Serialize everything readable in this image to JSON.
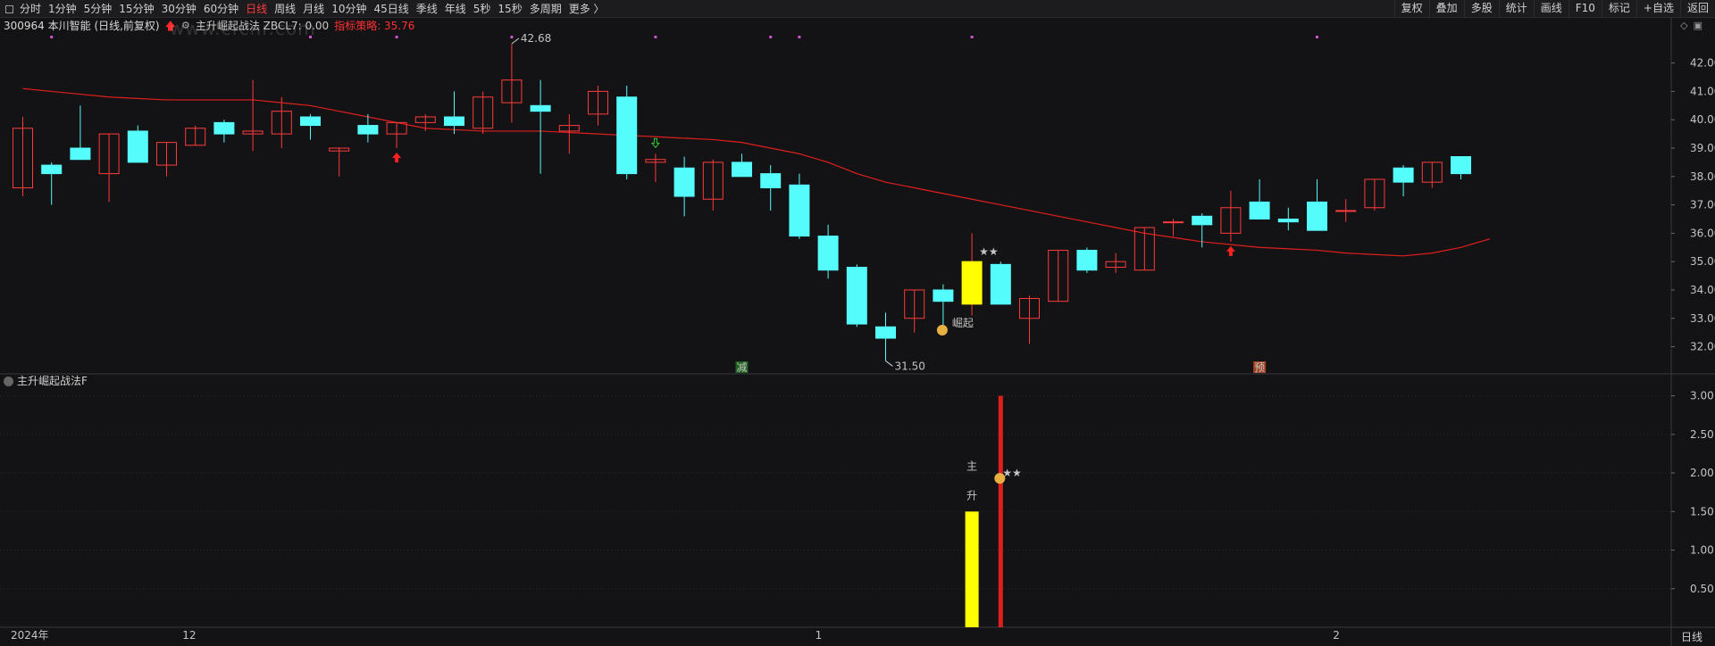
{
  "toolbar": {
    "periods": [
      "分时",
      "1分钟",
      "5分钟",
      "15分钟",
      "30分钟",
      "60分钟",
      "日线",
      "周线",
      "月线",
      "10分钟",
      "45日线",
      "季线",
      "年线",
      "5秒",
      "15秒",
      "多周期",
      "更多 〉"
    ],
    "active_period": "日线",
    "right_buttons": [
      "复权",
      "叠加",
      "多股",
      "统计",
      "画线",
      "F10",
      "标记",
      "+自选",
      "返回"
    ]
  },
  "info": {
    "stock": "300964 本川智能 (日线,前复权)",
    "formula": "主升崛起战法 ZBCL7: 0.00",
    "strategy": "指标策略: 35.76",
    "watermark": "www.cfcnr.com"
  },
  "subchart": {
    "title": "主升崛起战法F",
    "period": "日线"
  },
  "colors": {
    "up": "#ff3b3b",
    "down": "#54fcfc",
    "ma": "#e01e1e",
    "yellow": "#ffff00",
    "background": "#131315"
  },
  "chart_data": [
    {
      "type": "candlestick",
      "name": "main",
      "ylim": [
        31.2,
        42.9
      ],
      "y_ticks": [
        "42.00",
        "41.00",
        "40.00",
        "39.00",
        "38.00",
        "37.00",
        "36.00",
        "35.00",
        "34.00",
        "33.00",
        "32.00"
      ],
      "x_labels": [
        {
          "label": "2024年",
          "index": 0
        },
        {
          "label": "12",
          "index": 6
        },
        {
          "label": "1",
          "index": 28
        },
        {
          "label": "2",
          "index": 46
        }
      ],
      "annotations": [
        {
          "text": "42.68",
          "index": 17,
          "value": 42.68
        },
        {
          "text": "31.50",
          "index": 30,
          "value": 31.5
        },
        {
          "text": "崛起",
          "index": 32,
          "value": 32.9
        },
        {
          "text": "★★",
          "index": 33,
          "value": 35.1
        },
        {
          "text": "减",
          "index": 25,
          "value": 31.35
        },
        {
          "text": "预",
          "index": 43,
          "value": 31.35
        }
      ],
      "candles": [
        {
          "o": 37.6,
          "h": 40.1,
          "l": 37.3,
          "c": 39.7
        },
        {
          "o": 38.4,
          "h": 38.5,
          "l": 37.0,
          "c": 38.1
        },
        {
          "o": 39.0,
          "h": 40.5,
          "l": 38.6,
          "c": 38.6
        },
        {
          "o": 38.1,
          "h": 39.5,
          "l": 37.1,
          "c": 39.5
        },
        {
          "o": 39.6,
          "h": 39.8,
          "l": 38.5,
          "c": 38.5
        },
        {
          "o": 38.4,
          "h": 39.2,
          "l": 38.0,
          "c": 39.2
        },
        {
          "o": 39.1,
          "h": 39.8,
          "l": 39.1,
          "c": 39.7
        },
        {
          "o": 39.9,
          "h": 40.0,
          "l": 39.2,
          "c": 39.5
        },
        {
          "o": 39.5,
          "h": 41.4,
          "l": 38.9,
          "c": 39.6
        },
        {
          "o": 39.5,
          "h": 40.8,
          "l": 39.0,
          "c": 40.3
        },
        {
          "o": 40.1,
          "h": 40.2,
          "l": 39.3,
          "c": 39.8
        },
        {
          "o": 38.9,
          "h": 39.0,
          "l": 38.0,
          "c": 39.0
        },
        {
          "o": 39.8,
          "h": 40.2,
          "l": 39.2,
          "c": 39.5
        },
        {
          "o": 39.5,
          "h": 39.9,
          "l": 39.0,
          "c": 39.9
        },
        {
          "o": 39.9,
          "h": 40.2,
          "l": 39.6,
          "c": 40.1
        },
        {
          "o": 40.1,
          "h": 41.0,
          "l": 39.5,
          "c": 39.8
        },
        {
          "o": 39.7,
          "h": 41.0,
          "l": 39.5,
          "c": 40.8
        },
        {
          "o": 40.6,
          "h": 42.68,
          "l": 39.9,
          "c": 41.4
        },
        {
          "o": 40.5,
          "h": 41.4,
          "l": 38.1,
          "c": 40.3
        },
        {
          "o": 39.6,
          "h": 40.2,
          "l": 38.8,
          "c": 39.8
        },
        {
          "o": 40.2,
          "h": 41.2,
          "l": 39.8,
          "c": 41.0
        },
        {
          "o": 40.8,
          "h": 41.2,
          "l": 37.9,
          "c": 38.1
        },
        {
          "o": 38.5,
          "h": 38.8,
          "l": 37.8,
          "c": 38.6
        },
        {
          "o": 38.3,
          "h": 38.7,
          "l": 36.6,
          "c": 37.3
        },
        {
          "o": 37.2,
          "h": 38.6,
          "l": 36.8,
          "c": 38.5
        },
        {
          "o": 38.5,
          "h": 38.8,
          "l": 38.0,
          "c": 38.0
        },
        {
          "o": 38.1,
          "h": 38.4,
          "l": 36.8,
          "c": 37.6
        },
        {
          "o": 37.7,
          "h": 38.1,
          "l": 35.8,
          "c": 35.9
        },
        {
          "o": 35.9,
          "h": 36.3,
          "l": 34.4,
          "c": 34.7
        },
        {
          "o": 34.8,
          "h": 34.9,
          "l": 32.7,
          "c": 32.8
        },
        {
          "o": 32.7,
          "h": 33.2,
          "l": 31.5,
          "c": 32.3
        },
        {
          "o": 33.0,
          "h": 34.0,
          "l": 32.5,
          "c": 34.0
        },
        {
          "o": 34.0,
          "h": 34.2,
          "l": 32.4,
          "c": 33.6
        },
        {
          "o": 33.5,
          "h": 36.0,
          "l": 33.1,
          "c": 35.0
        },
        {
          "o": 34.9,
          "h": 35.0,
          "l": 33.5,
          "c": 33.5
        },
        {
          "o": 33.0,
          "h": 33.8,
          "l": 32.1,
          "c": 33.7
        },
        {
          "o": 33.6,
          "h": 35.4,
          "l": 33.6,
          "c": 35.4
        },
        {
          "o": 35.4,
          "h": 35.5,
          "l": 34.6,
          "c": 34.7
        },
        {
          "o": 34.8,
          "h": 35.3,
          "l": 34.6,
          "c": 35.0
        },
        {
          "o": 34.7,
          "h": 36.2,
          "l": 34.7,
          "c": 36.2
        },
        {
          "o": 36.4,
          "h": 36.5,
          "l": 35.9,
          "c": 36.4
        },
        {
          "o": 36.6,
          "h": 36.7,
          "l": 35.5,
          "c": 36.3
        },
        {
          "o": 36.0,
          "h": 37.5,
          "l": 35.7,
          "c": 36.9
        },
        {
          "o": 37.1,
          "h": 37.9,
          "l": 36.5,
          "c": 36.5
        },
        {
          "o": 36.5,
          "h": 36.9,
          "l": 36.1,
          "c": 36.4
        },
        {
          "o": 37.1,
          "h": 37.9,
          "l": 36.1,
          "c": 36.1
        },
        {
          "o": 36.8,
          "h": 37.2,
          "l": 36.4,
          "c": 36.8
        },
        {
          "o": 36.9,
          "h": 37.9,
          "l": 36.8,
          "c": 37.9
        },
        {
          "o": 38.3,
          "h": 38.4,
          "l": 37.3,
          "c": 37.8
        },
        {
          "o": 37.8,
          "h": 38.5,
          "l": 37.6,
          "c": 38.5
        },
        {
          "o": 38.7,
          "h": 38.7,
          "l": 37.9,
          "c": 38.1
        }
      ],
      "ma": [
        41.1,
        41.0,
        40.9,
        40.8,
        40.75,
        40.7,
        40.7,
        40.7,
        40.7,
        40.6,
        40.5,
        40.3,
        40.1,
        39.9,
        39.7,
        39.65,
        39.6,
        39.6,
        39.6,
        39.55,
        39.5,
        39.45,
        39.4,
        39.35,
        39.3,
        39.2,
        39.0,
        38.8,
        38.5,
        38.1,
        37.8,
        37.6,
        37.4,
        37.2,
        37.0,
        36.8,
        36.6,
        36.4,
        36.2,
        36.0,
        35.85,
        35.7,
        35.6,
        35.5,
        35.45,
        35.4,
        35.3,
        35.25,
        35.2,
        35.3,
        35.5,
        35.8
      ],
      "up_arrows": [
        13,
        42
      ],
      "down_arrows": [
        22
      ],
      "markers_top": [
        1,
        10,
        13,
        17,
        22,
        26,
        27,
        33,
        45
      ]
    },
    {
      "type": "bar",
      "name": "主升崛起战法F",
      "ylim": [
        0,
        3.25
      ],
      "y_ticks": [
        "3.00",
        "2.50",
        "2.00",
        "1.50",
        "1.00",
        "0.50"
      ],
      "bars": [
        {
          "index": 33,
          "value": 1.5,
          "color": "#ffff00"
        },
        {
          "index": 34,
          "value": 3.0,
          "color": "#e01e1e"
        }
      ],
      "labels": [
        {
          "text": "主",
          "index": 33,
          "value": 2.1
        },
        {
          "text": "升",
          "index": 33,
          "value": 1.72
        },
        {
          "text": "★★",
          "index": 34,
          "value": 2.0
        }
      ]
    }
  ]
}
